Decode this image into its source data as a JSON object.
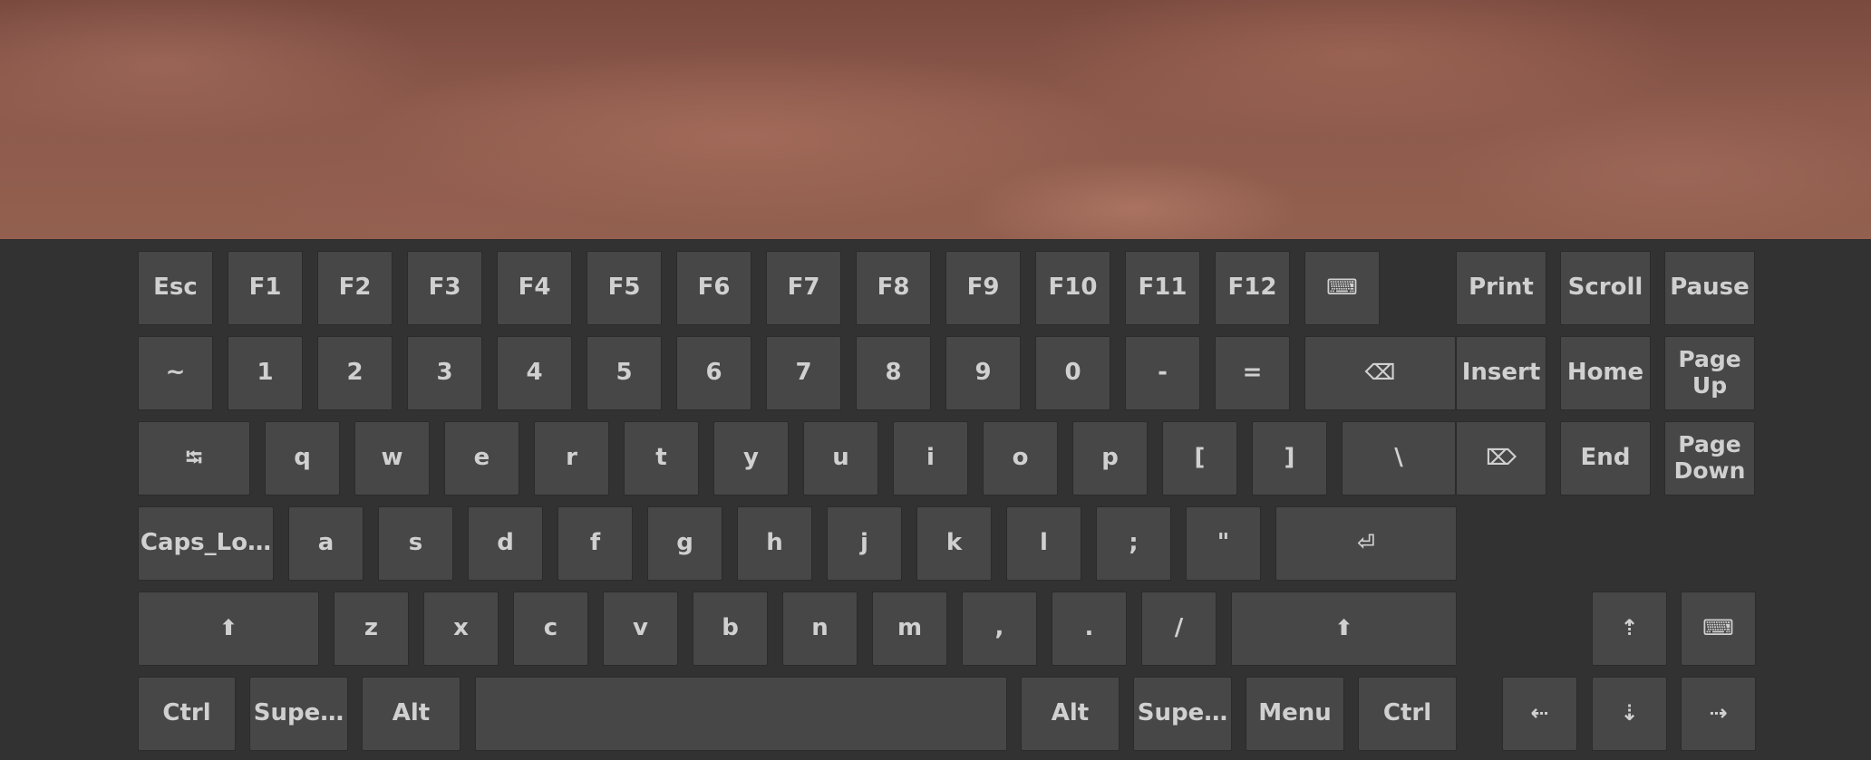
{
  "keyboard": {
    "row1": [
      "Esc",
      "F1",
      "F2",
      "F3",
      "F4",
      "F5",
      "F6",
      "F7",
      "F8",
      "F9",
      "F10",
      "F11",
      "F12",
      "⌨",
      "Print",
      "Scroll",
      "Pause"
    ],
    "row2": [
      "~",
      "1",
      "2",
      "3",
      "4",
      "5",
      "6",
      "7",
      "8",
      "9",
      "0",
      "-",
      "=",
      "⌫",
      "Insert",
      "Home",
      "Page\nUp"
    ],
    "row3": [
      "⭾",
      "q",
      "w",
      "e",
      "r",
      "t",
      "y",
      "u",
      "i",
      "o",
      "p",
      "[",
      "]",
      "\\",
      "⌦",
      "End",
      "Page\nDown"
    ],
    "row4": [
      "Caps_Lo…",
      "a",
      "s",
      "d",
      "f",
      "g",
      "h",
      "j",
      "k",
      "l",
      ";",
      "\"",
      "⏎"
    ],
    "row5": [
      "⬆",
      "z",
      "x",
      "c",
      "v",
      "b",
      "n",
      "m",
      ",",
      ".",
      "/",
      "⬆",
      "⇡",
      "⌨"
    ],
    "row6": [
      "Ctrl",
      "Supe…",
      "Alt",
      "",
      "Alt",
      "Supe…",
      "Menu",
      "Ctrl",
      "⇠",
      "⇣",
      "⇢"
    ]
  },
  "colors": {
    "key_background": "#474747",
    "key_text": "#d0d0d0",
    "panel_background": "#323232"
  }
}
